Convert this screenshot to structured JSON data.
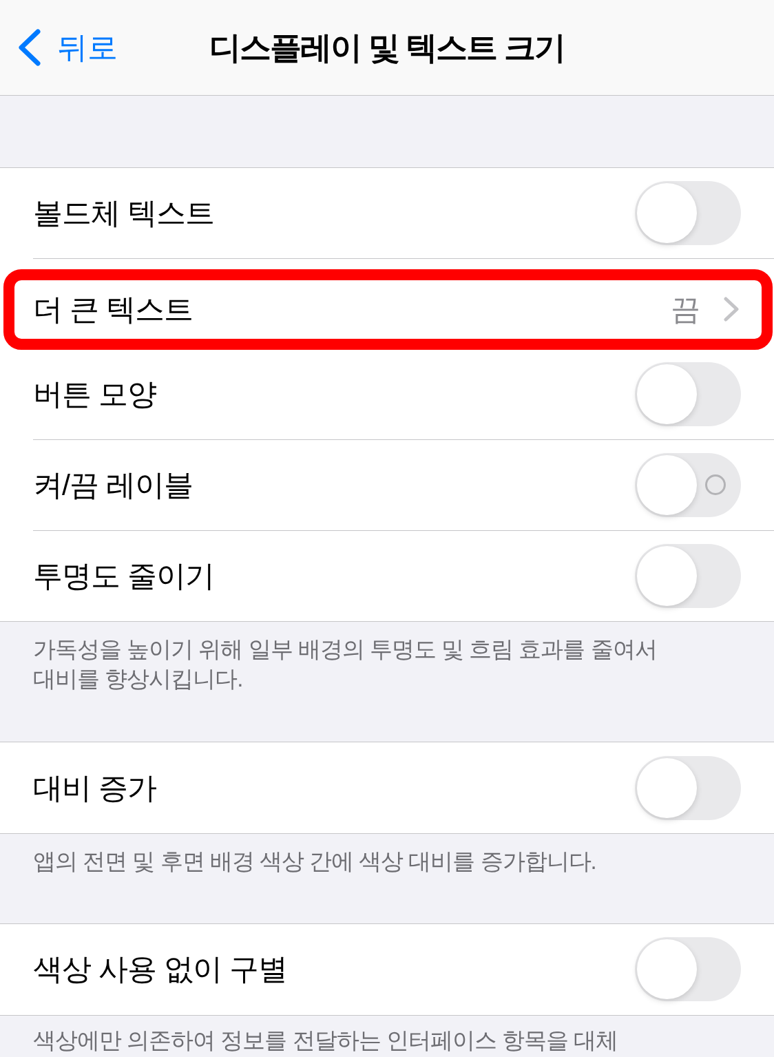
{
  "nav": {
    "back_label": "뒤로",
    "title": "디스플레이 및 텍스트 크기"
  },
  "sections": [
    {
      "rows": [
        {
          "kind": "toggle",
          "label": "볼드체 텍스트",
          "on": false,
          "off_symbol": false,
          "highlighted": false
        },
        {
          "kind": "disclosure",
          "label": "더 큰 텍스트",
          "value": "끔",
          "highlighted": true
        },
        {
          "kind": "toggle",
          "label": "버튼 모양",
          "on": false,
          "off_symbol": false,
          "highlighted": false
        },
        {
          "kind": "toggle",
          "label": "켜/끔 레이블",
          "on": false,
          "off_symbol": true,
          "highlighted": false
        },
        {
          "kind": "toggle",
          "label": "투명도 줄이기",
          "on": false,
          "off_symbol": false,
          "highlighted": false
        }
      ],
      "footer": "가독성을 높이기 위해 일부 배경의 투명도 및 흐림 효과를 줄여서\n대비를 향상시킵니다."
    },
    {
      "rows": [
        {
          "kind": "toggle",
          "label": "대비 증가",
          "on": false,
          "off_symbol": false,
          "highlighted": false
        }
      ],
      "footer": "앱의 전면 및 후면 배경 색상 간에 색상 대비를 증가합니다."
    },
    {
      "rows": [
        {
          "kind": "toggle",
          "label": "색상 사용 없이 구별",
          "on": false,
          "off_symbol": false,
          "highlighted": false
        }
      ],
      "footer": "색상에만 의존하여 정보를 전달하는 인터페이스 항목을 대체"
    }
  ]
}
